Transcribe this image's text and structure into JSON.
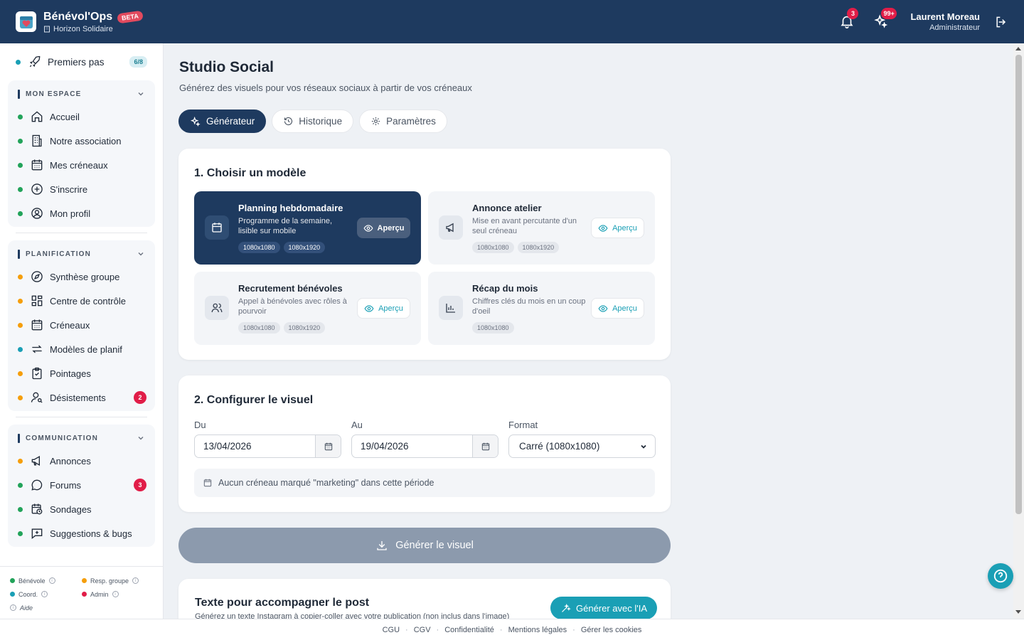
{
  "app": {
    "name": "Bénévol'Ops",
    "beta": "BETA",
    "org": "Horizon Solidaire",
    "notifications_count": "3",
    "activity_count": "99+",
    "user_name": "Laurent Moreau",
    "user_role": "Administrateur"
  },
  "sidebar": {
    "first_steps": {
      "label": "Premiers pas",
      "progress": "6/8"
    },
    "groups": [
      {
        "title": "MON ESPACE",
        "items": [
          {
            "label": "Accueil"
          },
          {
            "label": "Notre association"
          },
          {
            "label": "Mes créneaux"
          },
          {
            "label": "S'inscrire"
          },
          {
            "label": "Mon profil"
          }
        ]
      },
      {
        "title": "PLANIFICATION",
        "items": [
          {
            "label": "Synthèse groupe"
          },
          {
            "label": "Centre de contrôle"
          },
          {
            "label": "Créneaux"
          },
          {
            "label": "Modèles de planif"
          },
          {
            "label": "Pointages"
          },
          {
            "label": "Désistements",
            "badge": "2"
          }
        ]
      },
      {
        "title": "COMMUNICATION",
        "items": [
          {
            "label": "Annonces"
          },
          {
            "label": "Forums",
            "badge": "3"
          },
          {
            "label": "Sondages"
          },
          {
            "label": "Suggestions & bugs"
          }
        ]
      }
    ],
    "legend": {
      "benevole": "Bénévole",
      "resp_groupe": "Resp. groupe",
      "coord": "Coord.",
      "admin": "Admin",
      "aide": "Aide"
    }
  },
  "page": {
    "title": "Studio Social",
    "subtitle": "Générez des visuels pour vos réseaux sociaux à partir de vos créneaux",
    "tabs": [
      {
        "label": "Générateur"
      },
      {
        "label": "Historique"
      },
      {
        "label": "Paramètres"
      }
    ]
  },
  "step1": {
    "title": "1. Choisir un modèle",
    "preview_label": "Aperçu",
    "templates": [
      {
        "name": "Planning hebdomadaire",
        "desc": "Programme de la semaine, lisible sur mobile",
        "tags": [
          "1080x1080",
          "1080x1920"
        ]
      },
      {
        "name": "Annonce atelier",
        "desc": "Mise en avant percutante d'un seul créneau",
        "tags": [
          "1080x1080",
          "1080x1920"
        ]
      },
      {
        "name": "Recrutement bénévoles",
        "desc": "Appel à bénévoles avec rôles à pourvoir",
        "tags": [
          "1080x1080",
          "1080x1920"
        ]
      },
      {
        "name": "Récap du mois",
        "desc": "Chiffres clés du mois en un coup d'oeil",
        "tags": [
          "1080x1080"
        ]
      }
    ]
  },
  "step2": {
    "title": "2. Configurer le visuel",
    "from_label": "Du",
    "from_value": "13/04/2026",
    "to_label": "Au",
    "to_value": "19/04/2026",
    "format_label": "Format",
    "format_value": "Carré (1080x1080)",
    "notice": "Aucun créneau marqué \"marketing\" dans cette période"
  },
  "generate_label": "Générer le visuel",
  "text_section": {
    "title": "Texte pour accompagner le post",
    "subtitle": "Générez un texte Instagram à copier-coller avec votre publication (non inclus dans l'image)",
    "ai_button": "Générer avec l'IA"
  },
  "footer": [
    "CGU",
    "CGV",
    "Confidentialité",
    "Mentions légales",
    "Gérer les cookies"
  ],
  "colors": {
    "primary": "#1e3a5f",
    "accent": "#1a9fb5",
    "danger": "#e11d48"
  }
}
